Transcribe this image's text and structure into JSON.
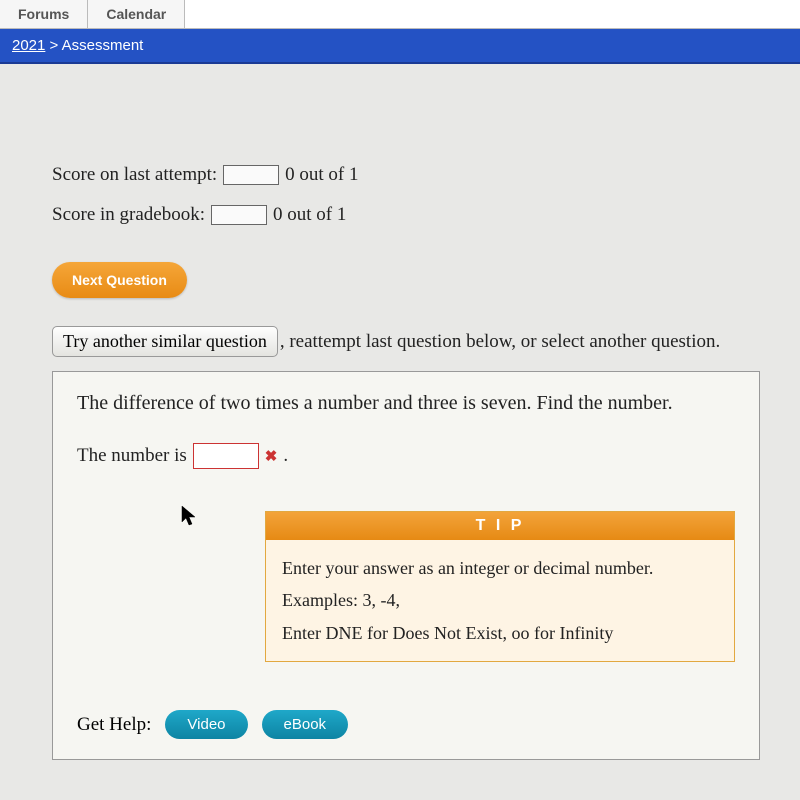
{
  "nav": {
    "tab1": "Forums",
    "tab2": "Calendar"
  },
  "breadcrumb": {
    "link": "2021",
    "sep": " > ",
    "current": "Assessment"
  },
  "scores": {
    "last_attempt_label": "Score on last attempt:",
    "last_attempt_value": "0 out of 1",
    "gradebook_label": "Score in gradebook:",
    "gradebook_value": "0 out of 1"
  },
  "buttons": {
    "next_question": "Next Question",
    "try_another": "Try another similar question"
  },
  "retry_text": ", reattempt last question below, or select another question.",
  "question": {
    "prompt": "The difference of two times a number and three is seven. Find the number.",
    "answer_prefix": "The number is",
    "answer_value": "",
    "wrong_mark": "✖",
    "answer_suffix": "."
  },
  "tip": {
    "header": "T I P",
    "line1": "Enter your answer as an integer or decimal number. Examples: 3, -4,",
    "line2": "Enter DNE for Does Not Exist, oo for Infinity"
  },
  "help": {
    "label": "Get Help:",
    "video": "Video",
    "ebook": "eBook"
  }
}
